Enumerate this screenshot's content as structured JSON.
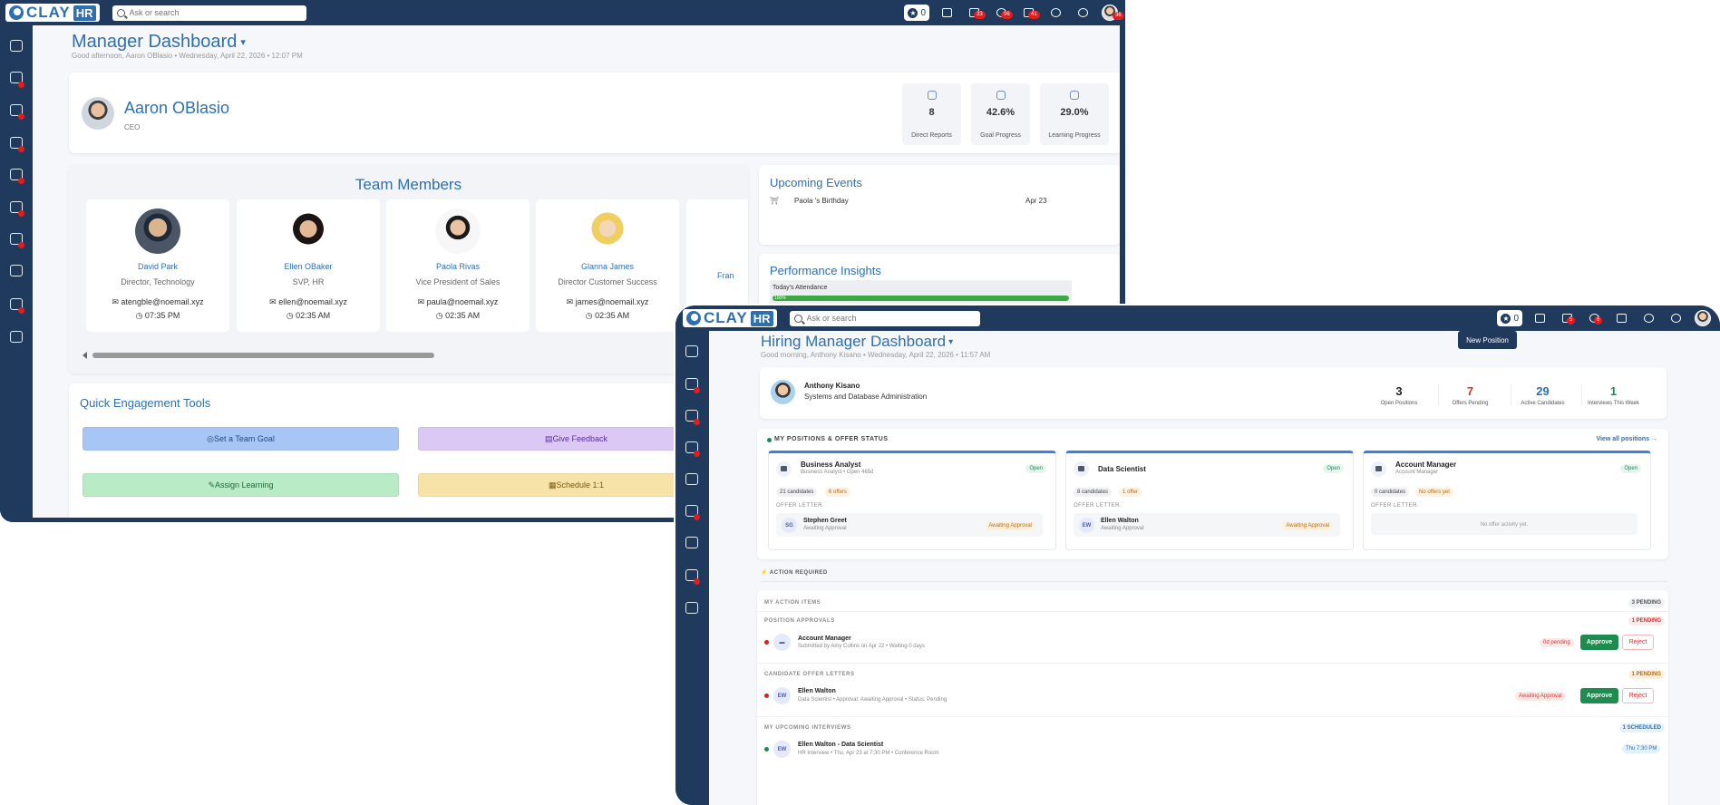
{
  "brand": {
    "logo_text": "CLAY",
    "logo_hr": "HR"
  },
  "manager": {
    "search_placeholder": "Ask or search",
    "points": "0",
    "badges": {
      "updates": "33",
      "notifications": "96",
      "messages": "41",
      "avatar": "36"
    },
    "title": "Manager Dashboard",
    "subtitle": "Good afternoon, Aaron OBlasio • Wednesday, April 22, 2026 • 12:07 PM",
    "profile": {
      "name": "Aaron OBlasio",
      "role": "CEO"
    },
    "kpis": [
      {
        "value": "8",
        "label": "Direct Reports",
        "icon": "people-icon"
      },
      {
        "value": "42.6%",
        "label": "Goal Progress",
        "icon": "target-icon"
      },
      {
        "value": "29.0%",
        "label": "Learning Progress",
        "icon": "book-icon"
      }
    ],
    "team_title": "Team Members",
    "team": [
      {
        "name": "David Park",
        "title": "Director, Technology",
        "email": "atengble@noemail.xyz",
        "time": "07:35 PM"
      },
      {
        "name": "Ellen OBaker",
        "title": "SVP, HR",
        "email": "ellen@noemail.xyz",
        "time": "02:35 AM"
      },
      {
        "name": "Paola Rivas",
        "title": "Vice President of Sales",
        "email": "paula@noemail.xyz",
        "time": "02:35 AM"
      },
      {
        "name": "Glanna James",
        "title": "Director Customer Success",
        "email": "james@noemail.xyz",
        "time": "02:35 AM"
      },
      {
        "name": "Fran",
        "title": "",
        "email": "",
        "time": ""
      }
    ],
    "events": {
      "title": "Upcoming Events",
      "items": [
        {
          "name": "Paola 's Birthday",
          "date": "Apr 23"
        }
      ]
    },
    "insights": {
      "title": "Performance Insights",
      "attendance_label": "Today's Attendance",
      "attendance_value": "100%",
      "attendance_fraction": 1.0
    },
    "quick": {
      "title": "Quick Engagement Tools",
      "buttons": [
        "Set a Team Goal",
        "Give Feedback",
        "Assign Learning",
        "Schedule 1:1"
      ]
    }
  },
  "hiring": {
    "search_placeholder": "Ask or search",
    "points": "0",
    "badges": {
      "updates": "5",
      "notifications": "6"
    },
    "title": "Hiring Manager Dashboard",
    "subtitle": "Good morning, Anthony Kisano • Wednesday, April 22, 2026 • 11:57 AM",
    "new_position": "New Position",
    "profile": {
      "name": "Anthony Kisano",
      "role": "Systems and Database Administration"
    },
    "stats": [
      {
        "value": "3",
        "label": "Open Positions",
        "color": "#222222"
      },
      {
        "value": "7",
        "label": "Offers Pending",
        "color": "#d32f2f"
      },
      {
        "value": "29",
        "label": "Active Candidates",
        "color": "#2f6fb0"
      },
      {
        "value": "1",
        "label": "Interviews This Week",
        "color": "#1e8b4f"
      }
    ],
    "positions_title": "MY POSITIONS & OFFER STATUS",
    "view_all": "View all positions →",
    "positions": [
      {
        "name": "Business Analyst",
        "sub": "Business Analyst • Open 465d",
        "status": "Open",
        "candidates": "21 candidates",
        "offers": "6 offers",
        "offer_label": "OFFER LETTER",
        "cand_initials": "SG",
        "cand_name": "Stephen Greet",
        "cand_status": "Awaiting Approval",
        "pill": "Awaiting Approval"
      },
      {
        "name": "Data Scientist",
        "sub": "",
        "status": "Open",
        "candidates": "8 candidates",
        "offers": "1 offer",
        "offer_label": "OFFER LETTER",
        "cand_initials": "EW",
        "cand_name": "Ellen Walton",
        "cand_status": "Awaiting Approval",
        "pill": "Awaiting Approval"
      },
      {
        "name": "Account Manager",
        "sub": "Account Manager",
        "status": "Open",
        "candidates": "0 candidates",
        "offers": "No offers yet",
        "offer_label": "OFFER LETTER",
        "empty": "No offer activity yet."
      }
    ],
    "action_required": "ACTION REQUIRED",
    "my_action_items": {
      "label": "MY ACTION ITEMS",
      "count": "3 PENDING"
    },
    "position_approvals": {
      "label": "POSITION APPROVALS",
      "count": "1 PENDING",
      "name": "Account Manager",
      "sub": "Submitted by Amy Collins on Apr 22 • Waiting 0 days",
      "tag": "0d pending",
      "approve": "Approve",
      "reject": "Reject"
    },
    "candidate_offers": {
      "label": "CANDIDATE OFFER LETTERS",
      "count": "1 PENDING",
      "initials": "EW",
      "name": "Ellen Walton",
      "sub": "Data Scientist • Approval: Awaiting Approval • Status: Pending",
      "tag": "Awaiting Approval",
      "approve": "Approve",
      "reject": "Reject"
    },
    "interviews": {
      "label": "MY UPCOMING INTERVIEWS",
      "count": "1 SCHEDULED",
      "initials": "EW",
      "name": "Ellen Walton - Data Scientist",
      "sub": "HR Interview • Thu, Apr 23 at 7:30 PM • Conference Room",
      "time": "Thu 7:30 PM"
    }
  }
}
